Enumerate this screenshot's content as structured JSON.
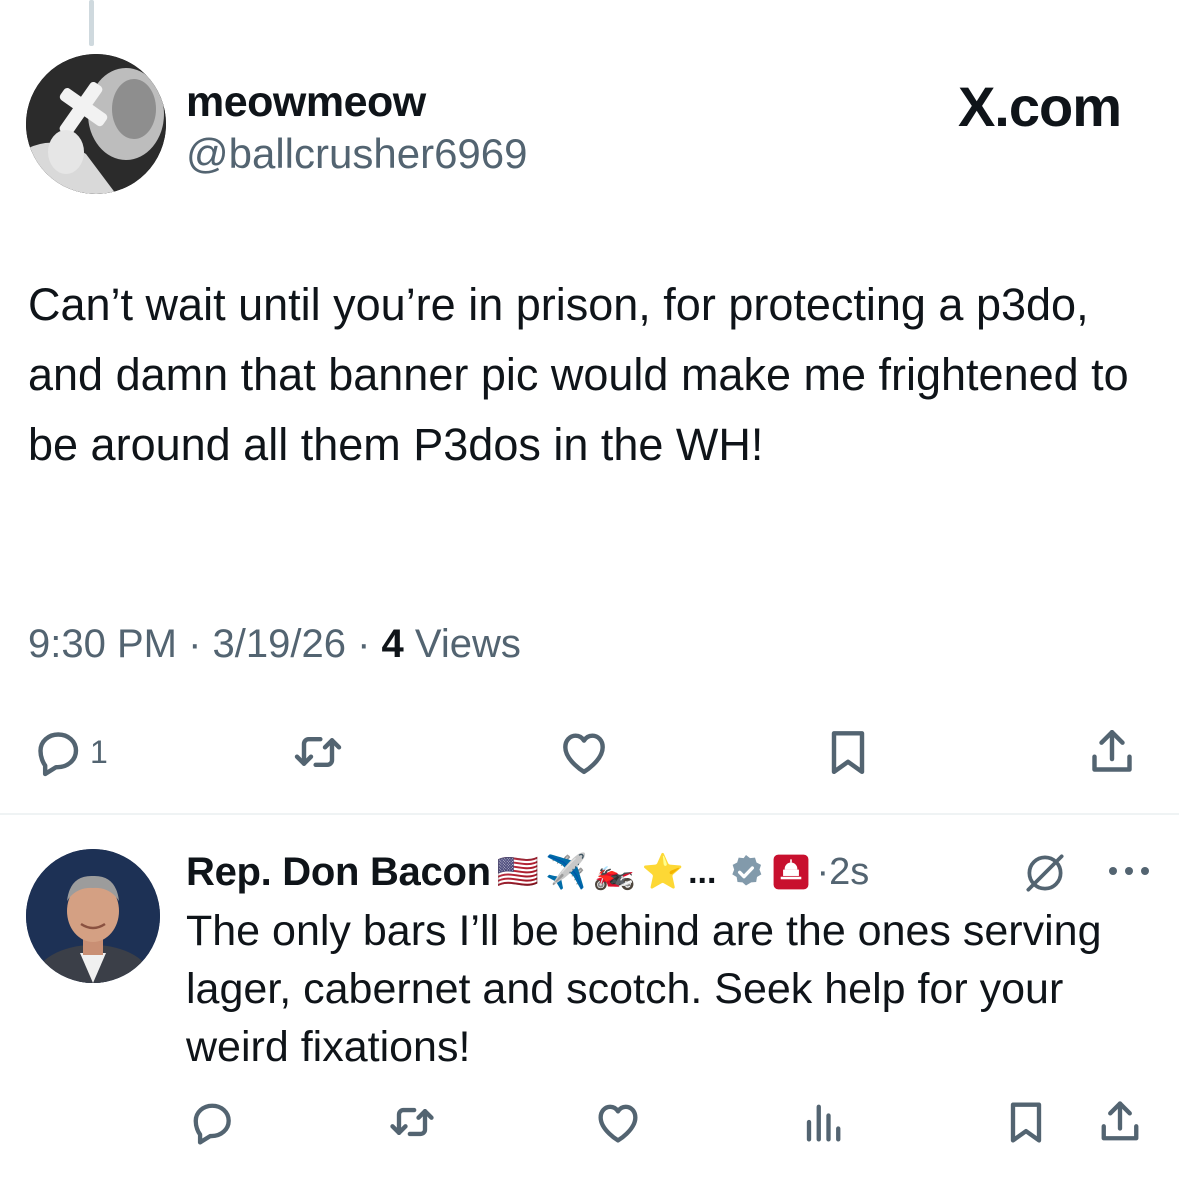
{
  "main_tweet": {
    "author_name": "meowmeow",
    "author_handle": "@ballcrusher6969",
    "brand": "X.com",
    "text": "Can’t wait until you’re in prison, for protecting a p3do, and damn that banner pic would make me frightened to be around all them P3dos in the WH!",
    "time": "9:30 PM",
    "date": "3/19/26",
    "separator": " · ",
    "views_count": "4",
    "views_label": " Views",
    "reply_count": "1"
  },
  "reply": {
    "author_name": "Rep. Don Bacon",
    "emojis": [
      "🇺🇸",
      "✈️",
      "🏍️",
      "⭐"
    ],
    "ellipsis": "...",
    "time": "·2s",
    "text": "The only bars I’ll be behind are the ones serving lager, cabernet and scotch. Seek help for your weird fixations!"
  },
  "colors": {
    "text_primary": "#0f1419",
    "text_secondary": "#536471",
    "verified_badge": "#829aab",
    "capitol_badge": "#c8102e",
    "divider": "#eff3f4"
  }
}
